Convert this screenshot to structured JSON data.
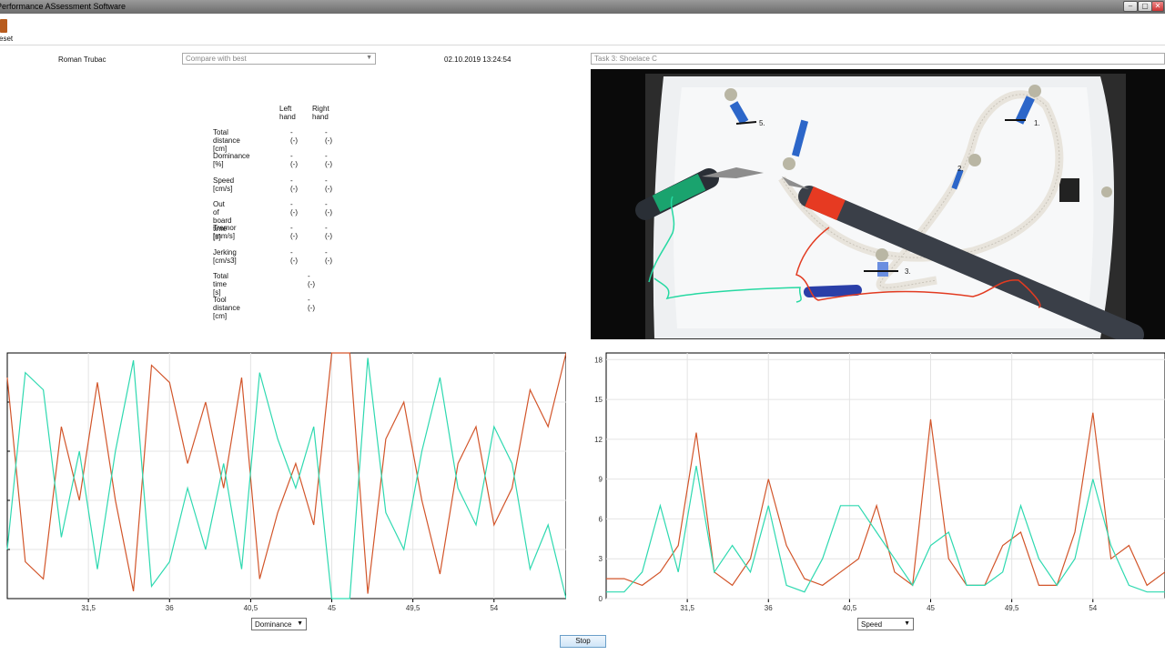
{
  "window": {
    "title": "Performance ASsessment Software",
    "min": "–",
    "max": "▢",
    "close": "✕"
  },
  "toolbar": {
    "reset_label": "eset",
    "icon": "reset-icon"
  },
  "header": {
    "user_name": "Roman Trubac",
    "compare_select": "Compare with best",
    "datetime": "02.10.2019 13:24:54",
    "task": "Task 3: Shoelace C"
  },
  "stats": {
    "col_left": "Left hand",
    "col_right": "Right hand",
    "rows": [
      {
        "label": "Total distance [cm]",
        "left": "-  (-)",
        "right": "-  (-)"
      },
      {
        "label": "Dominance [%]",
        "left": "-  (-)",
        "right": "-  (-)"
      },
      {
        "label": "Speed [cm/s]",
        "left": "-  (-)",
        "right": "-  (-)"
      },
      {
        "label": "Out of board time [s]",
        "left": "-  (-)",
        "right": "-  (-)"
      },
      {
        "label": "Tremor [mm/s]",
        "left": "-  (-)",
        "right": "-  (-)"
      },
      {
        "label": "Jerking [cm/s3]",
        "left": "-  (-)",
        "right": "-  (-)"
      }
    ],
    "combined": [
      {
        "label": "Total time [s]",
        "value": "-  (-)"
      },
      {
        "label": "Tool distance [cm]",
        "value": "-  (-)"
      }
    ]
  },
  "video": {
    "markers": [
      "1.",
      "2.",
      "3.",
      "5."
    ]
  },
  "charts": {
    "left": {
      "selector": "Dominance",
      "xticks": [
        "31,5",
        "36",
        "40,5",
        "45",
        "49,5",
        "54"
      ]
    },
    "right": {
      "selector": "Speed",
      "xticks": [
        "31,5",
        "36",
        "40,5",
        "45",
        "49,5",
        "54"
      ],
      "yticks": [
        "0",
        "3",
        "6",
        "9",
        "12",
        "15",
        "18"
      ]
    }
  },
  "colors": {
    "left_series": "#d2552a",
    "right_series": "#2ed9b0",
    "accent": "#6a9fc9"
  },
  "controls": {
    "stop_label": "Stop"
  },
  "chart_data": [
    {
      "type": "line",
      "ylabel": "",
      "xlim": [
        27,
        58
      ],
      "ylim": [
        0,
        100
      ],
      "x": [
        27,
        28,
        29,
        30,
        31,
        32,
        33,
        34,
        35,
        36,
        37,
        38,
        39,
        40,
        41,
        42,
        43,
        44,
        45,
        46,
        47,
        48,
        49,
        50,
        51,
        52,
        53,
        54,
        55,
        56,
        57,
        58
      ],
      "series": [
        {
          "values": [
            90,
            15,
            8,
            70,
            40,
            88,
            40,
            3,
            95,
            88,
            55,
            80,
            45,
            90,
            8,
            35,
            55,
            30,
            100,
            100,
            2,
            65,
            80,
            40,
            10,
            55,
            70,
            30,
            45,
            85,
            70,
            100
          ]
        },
        {
          "values": [
            20,
            92,
            85,
            25,
            60,
            12,
            60,
            97,
            5,
            15,
            45,
            20,
            55,
            12,
            92,
            65,
            45,
            70,
            0,
            0,
            98,
            35,
            20,
            60,
            90,
            45,
            30,
            70,
            55,
            12,
            30,
            0
          ]
        }
      ]
    },
    {
      "type": "line",
      "ylabel": "",
      "xlim": [
        27,
        58
      ],
      "ylim": [
        0,
        18.5
      ],
      "x": [
        27,
        28,
        29,
        30,
        31,
        32,
        33,
        34,
        35,
        36,
        37,
        38,
        39,
        40,
        41,
        42,
        43,
        44,
        45,
        46,
        47,
        48,
        49,
        50,
        51,
        52,
        53,
        54,
        55,
        56,
        57,
        58
      ],
      "series": [
        {
          "values": [
            1.5,
            1.5,
            1,
            2,
            4,
            12.5,
            2,
            1,
            3,
            9,
            4,
            1.5,
            1,
            2,
            3,
            7,
            2,
            1,
            13.5,
            3,
            1,
            1,
            4,
            5,
            1,
            1,
            5,
            14,
            3,
            4,
            1,
            2
          ]
        },
        {
          "values": [
            0.5,
            0.5,
            2,
            7,
            2,
            10,
            2,
            4,
            2,
            7,
            1,
            0.5,
            3,
            7,
            7,
            5,
            3,
            1,
            4,
            5,
            1,
            1,
            2,
            7,
            3,
            1,
            3,
            9,
            4,
            1,
            0.5,
            0.5
          ]
        }
      ]
    }
  ]
}
